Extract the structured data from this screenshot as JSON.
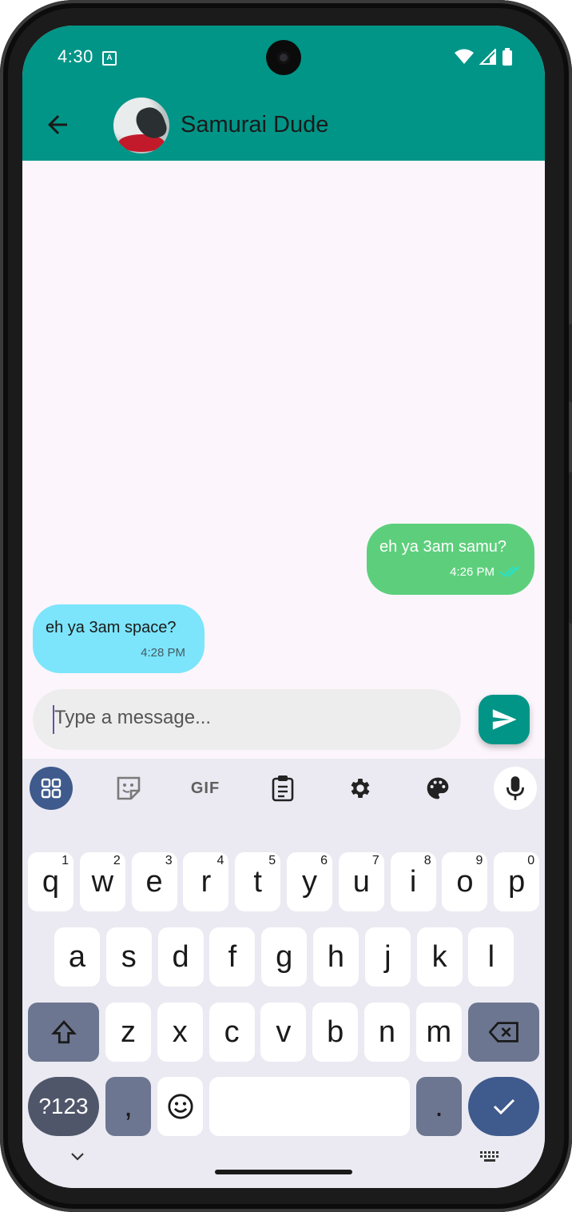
{
  "status": {
    "time": "4:30"
  },
  "chat": {
    "contact_name": "Samurai Dude"
  },
  "messages": [
    {
      "direction": "outgoing",
      "text": "eh ya 3am samu?",
      "time": "4:26 PM",
      "read": true
    },
    {
      "direction": "incoming",
      "text": "eh ya 3am space?",
      "time": "4:28 PM"
    }
  ],
  "composer": {
    "placeholder": "Type a message...",
    "value": ""
  },
  "keyboard": {
    "toolbar": [
      "apps-icon",
      "sticker-icon",
      "GIF",
      "clipboard-icon",
      "settings-icon",
      "palette-icon",
      "mic-icon"
    ],
    "row1": [
      {
        "k": "q",
        "h": "1"
      },
      {
        "k": "w",
        "h": "2"
      },
      {
        "k": "e",
        "h": "3"
      },
      {
        "k": "r",
        "h": "4"
      },
      {
        "k": "t",
        "h": "5"
      },
      {
        "k": "y",
        "h": "6"
      },
      {
        "k": "u",
        "h": "7"
      },
      {
        "k": "i",
        "h": "8"
      },
      {
        "k": "o",
        "h": "9"
      },
      {
        "k": "p",
        "h": "0"
      }
    ],
    "row2": [
      "a",
      "s",
      "d",
      "f",
      "g",
      "h",
      "j",
      "k",
      "l"
    ],
    "row3": [
      "z",
      "x",
      "c",
      "v",
      "b",
      "n",
      "m"
    ],
    "symbols_label": "?123",
    "comma": ",",
    "period": "."
  },
  "colors": {
    "primary": "#009587",
    "outgoing_bubble": "#5dcf7c",
    "incoming_bubble": "#7ce5fb",
    "keyboard_accent": "#3f5a8c"
  }
}
